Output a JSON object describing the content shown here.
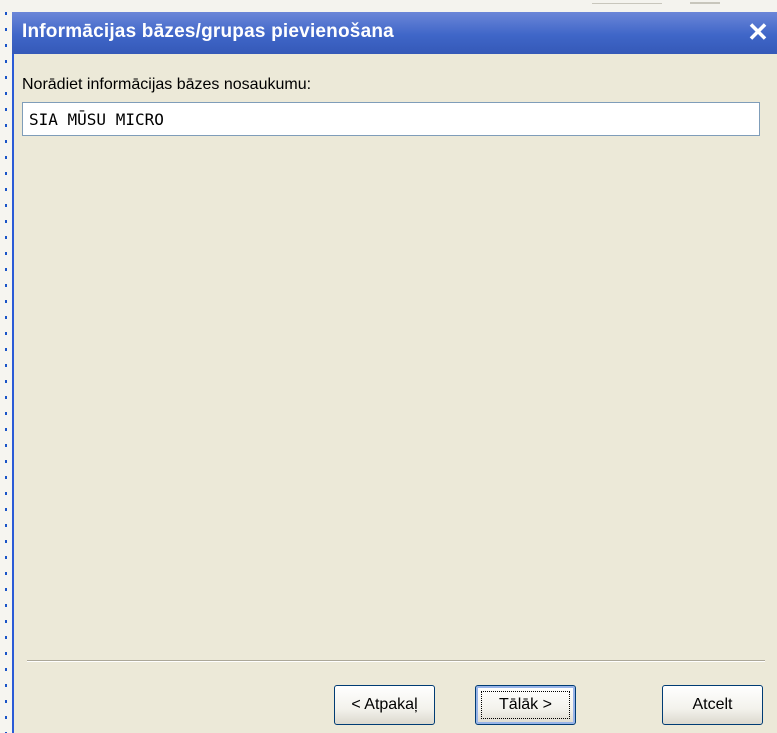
{
  "dialog": {
    "title": "Informācijas bāzes/grupas pievienošana",
    "close_symbol": "✕",
    "prompt_label": "Norādiet informācijas bāzes nosaukumu:",
    "name_value": "SIA MŪSU MICRO"
  },
  "buttons": {
    "back_label": "< Atpakaļ",
    "next_label": "Tālāk >",
    "cancel_label": "Atcelt"
  },
  "colors": {
    "title_bar": "#3f66c8",
    "dialog_bg": "#ece9d8",
    "button_border": "#003c74"
  },
  "icons": {
    "close": "close-icon"
  }
}
